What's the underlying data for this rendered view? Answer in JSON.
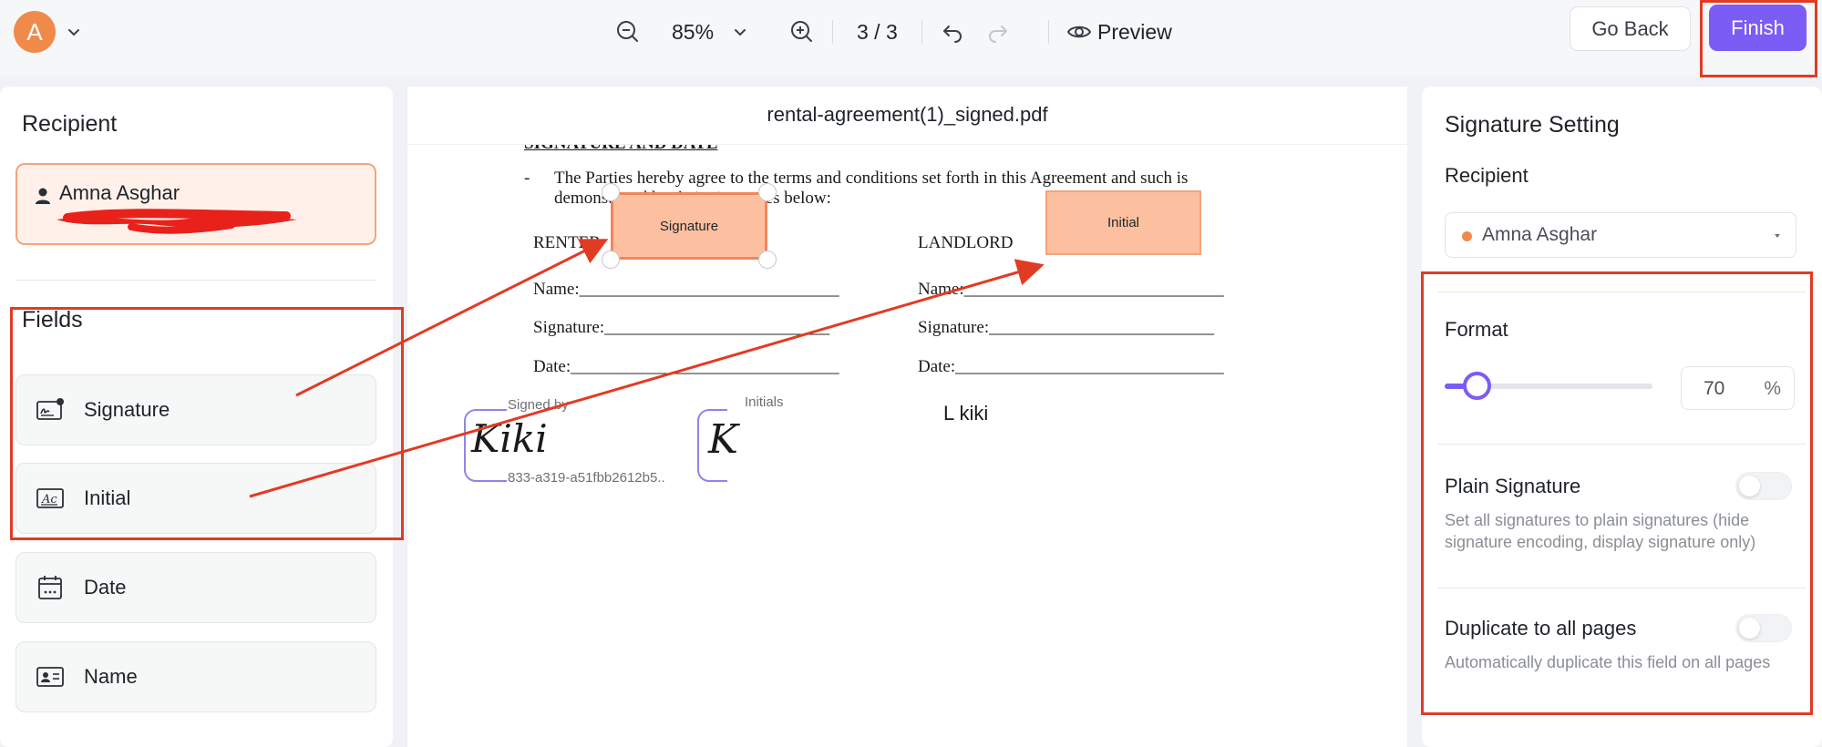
{
  "topbar": {
    "avatar_letter": "A",
    "zoom": "85%",
    "page_indicator": "3 / 3",
    "preview_label": "Preview",
    "go_back_label": "Go Back",
    "finish_label": "Finish",
    "accent_color": "#7b5cf5"
  },
  "left_panel": {
    "recipient_title": "Recipient",
    "recipient_name": "Amna Asghar",
    "fields_title": "Fields",
    "fields": [
      {
        "label": "Signature",
        "icon": "signature-icon"
      },
      {
        "label": "Initial",
        "icon": "initial-icon"
      },
      {
        "label": "Date",
        "icon": "calendar-icon"
      },
      {
        "label": "Name",
        "icon": "name-card-icon"
      }
    ]
  },
  "document": {
    "file_name": "rental-agreement(1)_signed.pdf",
    "heading": "SIGNATURE AND DATE",
    "paragraph_line1": "The Parties hereby agree to the terms and conditions set forth in this Agreement and such is",
    "paragraph_line2": "demonstrated by their signatures below:",
    "renter_label": "RENTER",
    "landlord_label": "LANDLORD",
    "name_line": "Name:______________________________",
    "signature_line": "Signature:__________________________",
    "date_line": "Date:_______________________________",
    "signature_field_label": "Signature",
    "initial_field_label": "Initial",
    "signed_by_label": "Signed by",
    "signed_by_value": "Kiki",
    "signed_hash": "833-a319-a51fbb2612b5..",
    "initials_label": "Initials",
    "initials_value": "K",
    "landlord_name": "L kiki"
  },
  "right_panel": {
    "title": "Signature Setting",
    "recipient_label": "Recipient",
    "recipient_value": "Amna Asghar",
    "format_label": "Format",
    "format_value": "70",
    "format_unit": "%",
    "slider_fraction": 0.1,
    "plain_signature_label": "Plain Signature",
    "plain_signature_desc": "Set all signatures to plain signatures (hide signature encoding, display signature only)",
    "plain_signature_on": false,
    "duplicate_label": "Duplicate to all pages",
    "duplicate_desc": "Automatically duplicate this field on all pages",
    "duplicate_on": false
  },
  "annotation_color": "#e23b24"
}
